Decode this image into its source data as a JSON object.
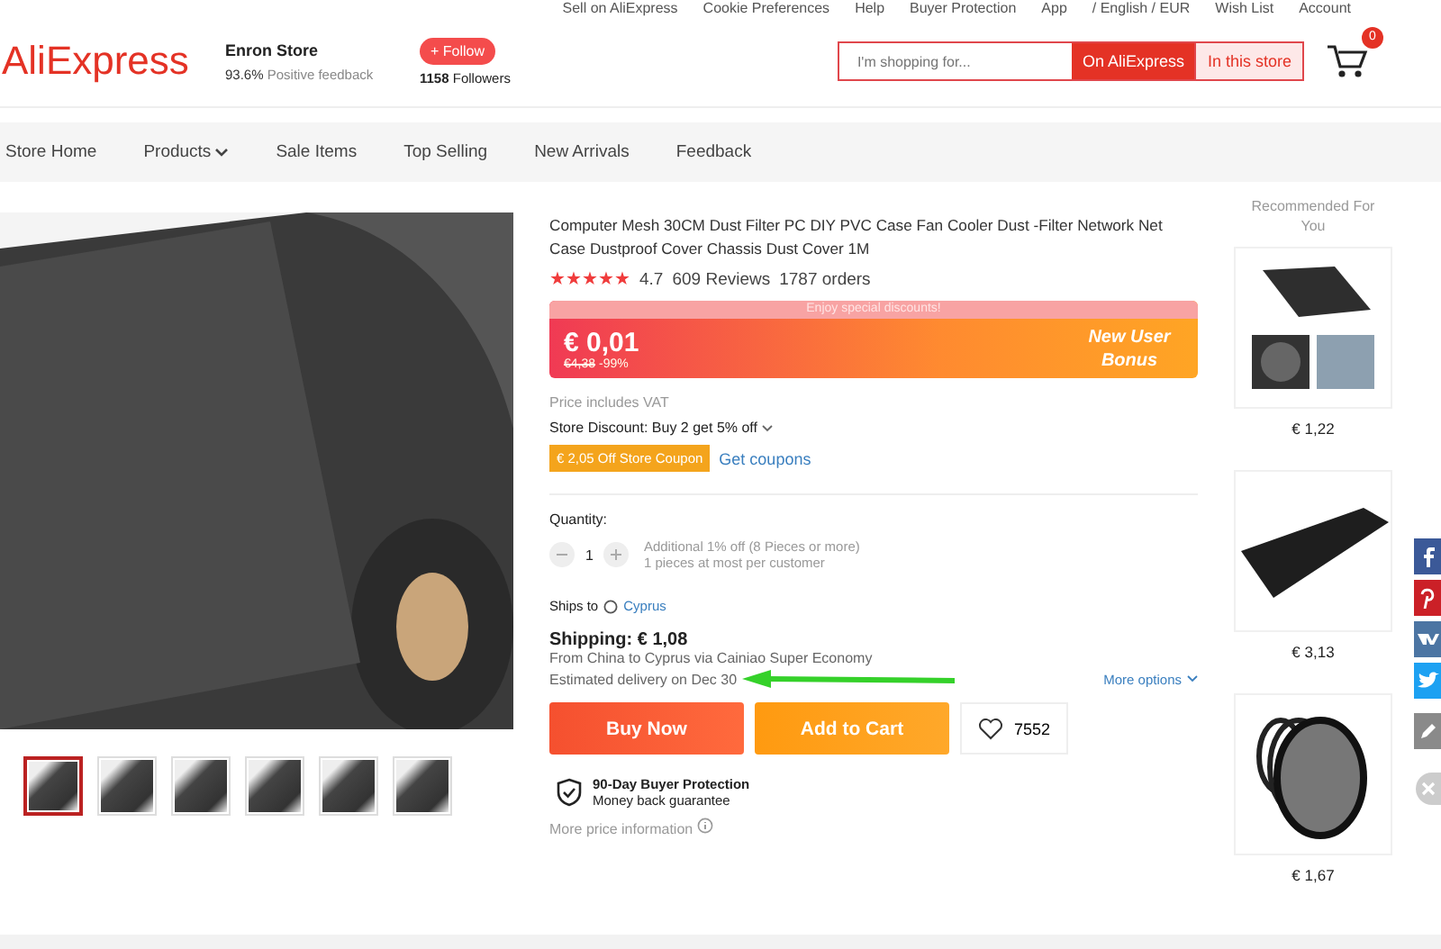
{
  "top_bar": {
    "links": [
      "Sell on AliExpress",
      "Cookie Preferences",
      "Help",
      "Buyer Protection",
      "App",
      "/ English / EUR",
      "Wish List",
      "Account"
    ]
  },
  "header": {
    "logo": "AliExpress",
    "store_name": "Enron Store",
    "feedback_rate": "93.6%",
    "feedback_label": "Positive feedback",
    "follow_button": "+ Follow",
    "followers_count": "1158",
    "followers_label": "Followers",
    "search": {
      "placeholder": "I'm shopping for...",
      "scopes": [
        {
          "label": "On AliExpress",
          "selected": true
        },
        {
          "label": "In this store",
          "selected": false
        }
      ]
    },
    "cart_count": "0"
  },
  "nav": {
    "items": [
      {
        "label": "Store Home",
        "has_dropdown": false
      },
      {
        "label": "Products",
        "has_dropdown": true
      },
      {
        "label": "Sale Items",
        "has_dropdown": false
      },
      {
        "label": "Top Selling",
        "has_dropdown": false
      },
      {
        "label": "New Arrivals",
        "has_dropdown": false
      },
      {
        "label": "Feedback",
        "has_dropdown": false
      }
    ]
  },
  "gallery": {
    "thumbnails": [
      {
        "selected": true
      },
      {
        "selected": false
      },
      {
        "selected": false
      },
      {
        "selected": false
      },
      {
        "selected": false
      },
      {
        "selected": false
      }
    ]
  },
  "product": {
    "title": "Computer Mesh 30CM Dust Filter PC DIY PVC Case Fan Cooler Dust -Filter Network Net Case Dustproof Cover Chassis Dust Cover 1M",
    "stars": 5,
    "rating": "4.7",
    "reviews": "609 Reviews",
    "orders": "1787 orders",
    "promo": {
      "banner": "Enjoy special discounts!",
      "price": "€ 0,01",
      "old_price": "€4,38",
      "discount": "-99%",
      "badge": "New User Bonus"
    },
    "vat_note": "Price includes VAT",
    "store_discount": "Store Discount: Buy 2 get 5% off",
    "coupon": "€ 2,05 Off Store Coupon",
    "get_coupons": "Get coupons",
    "quantity_label": "Quantity:",
    "quantity": "1",
    "quantity_note_1": "Additional 1% off (8 Pieces or more)",
    "quantity_note_2": "1 pieces at most per customer",
    "ships_to_label": "Ships to",
    "ships_to": "Cyprus",
    "shipping": "Shipping: € 1,08",
    "shipping_from": "From China to Cyprus via Cainiao Super Economy",
    "delivery": "Estimated delivery on Dec 30",
    "more_options": "More options",
    "buy_now": "Buy Now",
    "add_to_cart": "Add to Cart",
    "wishlist_count": "7552",
    "protection_title": "90-Day Buyer Protection",
    "protection_sub": "Money back guarantee",
    "more_price_info": "More price information"
  },
  "recommended": {
    "title": "Recommended For You",
    "items": [
      {
        "price": "€ 1,22",
        "kind": "panels"
      },
      {
        "price": "€ 3,13",
        "kind": "roll"
      },
      {
        "price": "€ 1,67",
        "kind": "rings"
      }
    ]
  },
  "share": {
    "buttons": [
      {
        "kind": "facebook",
        "color": "#3b5998"
      },
      {
        "kind": "pinterest",
        "color": "#cb2027"
      },
      {
        "kind": "vk",
        "color": "#4c75a3"
      },
      {
        "kind": "twitter",
        "color": "#1da1f2"
      },
      {
        "kind": "edit",
        "color": "#8a8a8a"
      }
    ]
  }
}
